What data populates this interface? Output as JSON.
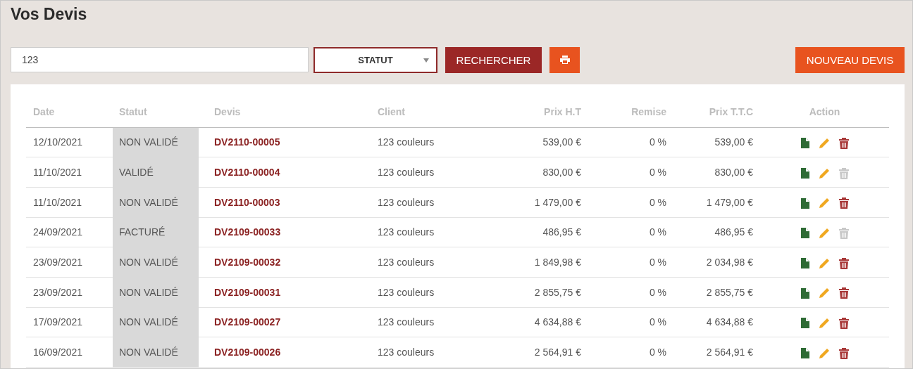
{
  "title": "Vos Devis",
  "search": {
    "value": "123"
  },
  "status_select": {
    "label": "STATUT"
  },
  "search_button": "RECHERCHER",
  "new_button": "NOUVEAU DEVIS",
  "table": {
    "columns": [
      "Date",
      "Statut",
      "Devis",
      "Client",
      "Prix H.T",
      "Remise",
      "Prix T.T.C",
      "Action"
    ],
    "rows": [
      {
        "date": "12/10/2021",
        "status": "NON VALIDÉ",
        "devis": "DV2110-00005",
        "client": "123 couleurs",
        "prix_ht": "539,00 €",
        "remise": "0 %",
        "prix_ttc": "539,00 €",
        "delete_disabled": false
      },
      {
        "date": "11/10/2021",
        "status": "VALIDÉ",
        "devis": "DV2110-00004",
        "client": "123 couleurs",
        "prix_ht": "830,00 €",
        "remise": "0 %",
        "prix_ttc": "830,00 €",
        "delete_disabled": true
      },
      {
        "date": "11/10/2021",
        "status": "NON VALIDÉ",
        "devis": "DV2110-00003",
        "client": "123 couleurs",
        "prix_ht": "1 479,00 €",
        "remise": "0 %",
        "prix_ttc": "1 479,00 €",
        "delete_disabled": false
      },
      {
        "date": "24/09/2021",
        "status": "FACTURÉ",
        "devis": "DV2109-00033",
        "client": "123 couleurs",
        "prix_ht": "486,95 €",
        "remise": "0 %",
        "prix_ttc": "486,95 €",
        "delete_disabled": true
      },
      {
        "date": "23/09/2021",
        "status": "NON VALIDÉ",
        "devis": "DV2109-00032",
        "client": "123 couleurs",
        "prix_ht": "1 849,98 €",
        "remise": "0 %",
        "prix_ttc": "2 034,98 €",
        "delete_disabled": false
      },
      {
        "date": "23/09/2021",
        "status": "NON VALIDÉ",
        "devis": "DV2109-00031",
        "client": "123 couleurs",
        "prix_ht": "2 855,75 €",
        "remise": "0 %",
        "prix_ttc": "2 855,75 €",
        "delete_disabled": false
      },
      {
        "date": "17/09/2021",
        "status": "NON VALIDÉ",
        "devis": "DV2109-00027",
        "client": "123 couleurs",
        "prix_ht": "4 634,88 €",
        "remise": "0 %",
        "prix_ttc": "4 634,88 €",
        "delete_disabled": false
      },
      {
        "date": "16/09/2021",
        "status": "NON VALIDÉ",
        "devis": "DV2109-00026",
        "client": "123 couleurs",
        "prix_ht": "2 564,91 €",
        "remise": "0 %",
        "prix_ttc": "2 564,91 €",
        "delete_disabled": false
      }
    ]
  }
}
